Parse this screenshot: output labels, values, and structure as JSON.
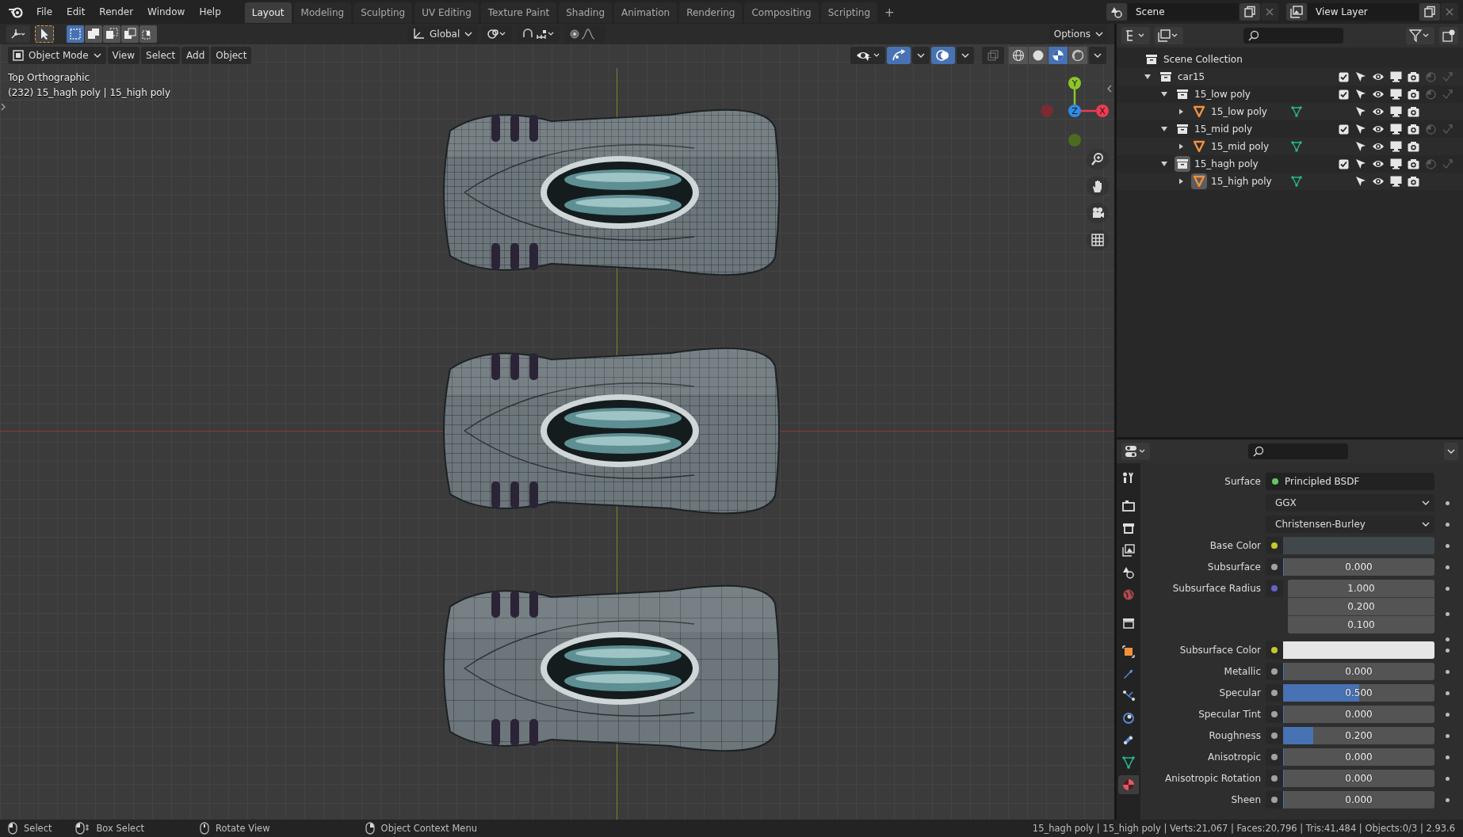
{
  "top_bar": {
    "menus": [
      "File",
      "Edit",
      "Render",
      "Window",
      "Help"
    ],
    "workspaces": [
      {
        "label": "Layout",
        "selected": true
      },
      {
        "label": "Modeling",
        "selected": false
      },
      {
        "label": "Sculpting",
        "selected": false
      },
      {
        "label": "UV Editing",
        "selected": false
      },
      {
        "label": "Texture Paint",
        "selected": false
      },
      {
        "label": "Shading",
        "selected": false
      },
      {
        "label": "Animation",
        "selected": false
      },
      {
        "label": "Rendering",
        "selected": false
      },
      {
        "label": "Compositing",
        "selected": false
      },
      {
        "label": "Scripting",
        "selected": false
      }
    ],
    "add_tab": "+",
    "scene": "Scene",
    "view_layer": "View Layer"
  },
  "viewport": {
    "select_modes": [
      {
        "kind": "set",
        "selected": true
      },
      {
        "kind": "extend",
        "selected": false
      },
      {
        "kind": "subtract",
        "selected": false
      },
      {
        "kind": "invert",
        "selected": false
      },
      {
        "kind": "intersect",
        "selected": false
      }
    ],
    "orientation": "Global",
    "options": "Options",
    "mode": "Object Mode",
    "menus": [
      "View",
      "Select",
      "Add",
      "Object"
    ],
    "shading": [
      {
        "kind": "wireframe",
        "selected": false
      },
      {
        "kind": "solid",
        "selected": false
      },
      {
        "kind": "material",
        "selected": true
      },
      {
        "kind": "rendered",
        "selected": false
      }
    ],
    "view_name": "Top Orthographic",
    "active_info": "(232) 15_hagh poly | 15_high poly",
    "gizmo": {
      "y": "Y",
      "z": "Z",
      "x": "X"
    }
  },
  "outliner": {
    "items": [
      {
        "kind": "collection",
        "label": "Scene Collection",
        "selected": false,
        "children": [
          {
            "kind": "collection",
            "label": "car15",
            "expanded": true,
            "checked": true,
            "selected": false,
            "children": [
              {
                "kind": "collection",
                "label": "15_low poly",
                "expanded": true,
                "checked": true,
                "selected": false,
                "children": [
                  {
                    "kind": "object",
                    "label": "15_low poly",
                    "expanded": false,
                    "selected": false
                  }
                ]
              },
              {
                "kind": "collection",
                "label": "15_mid poly",
                "expanded": true,
                "checked": true,
                "selected": false,
                "children": [
                  {
                    "kind": "object",
                    "label": "15_mid poly",
                    "expanded": false,
                    "selected": false
                  }
                ]
              },
              {
                "kind": "collection",
                "label": "15_hagh poly",
                "expanded": true,
                "checked": true,
                "selected": true,
                "children": [
                  {
                    "kind": "object",
                    "label": "15_high poly",
                    "expanded": false,
                    "selected": true
                  }
                ]
              }
            ]
          }
        ]
      }
    ]
  },
  "properties": {
    "tabs": [
      {
        "kind": "tool",
        "selected": false
      },
      {
        "kind": "render",
        "selected": false
      },
      {
        "kind": "output",
        "selected": false
      },
      {
        "kind": "view_layer",
        "selected": false
      },
      {
        "kind": "scene",
        "selected": false
      },
      {
        "kind": "world",
        "selected": false
      },
      {
        "kind": "collection",
        "selected": false
      },
      {
        "kind": "object",
        "selected": false
      },
      {
        "kind": "modifier",
        "selected": false
      },
      {
        "kind": "particles",
        "selected": false
      },
      {
        "kind": "physics",
        "selected": false
      },
      {
        "kind": "constraint",
        "selected": false
      },
      {
        "kind": "data",
        "selected": false
      },
      {
        "kind": "material",
        "selected": true
      }
    ],
    "rows": [
      {
        "kind": "link",
        "label": "Surface",
        "color": "#63c763",
        "value": "Principled BSDF"
      },
      {
        "kind": "dropdown",
        "value": "GGX"
      },
      {
        "kind": "dropdown",
        "value": "Christensen-Burley"
      },
      {
        "kind": "color",
        "label": "Base Color",
        "color": "#c7c729",
        "swatch": {
          "color": "#41484c"
        }
      },
      {
        "kind": "slider",
        "label": "Subsurface",
        "color": "#a1a1a1",
        "value": "0.000",
        "level": 0
      },
      {
        "kind": "vector",
        "label": "Subsurface Radius",
        "color": "#6363c7",
        "values": [
          "1.000",
          "0.200",
          "0.100"
        ]
      },
      {
        "kind": "color",
        "label": "Subsurface Color",
        "color": "#c7c729",
        "swatch": {
          "color": "#e6e6e6"
        }
      },
      {
        "kind": "slider",
        "label": "Metallic",
        "color": "#a1a1a1",
        "value": "0.000",
        "level": 0
      },
      {
        "kind": "slider",
        "label": "Specular",
        "color": "#a1a1a1",
        "value": "0.500",
        "level": 0.5
      },
      {
        "kind": "slider",
        "label": "Specular Tint",
        "color": "#a1a1a1",
        "value": "0.000",
        "level": 0
      },
      {
        "kind": "slider",
        "label": "Roughness",
        "color": "#a1a1a1",
        "value": "0.200",
        "level": 0.2
      },
      {
        "kind": "slider",
        "label": "Anisotropic",
        "color": "#a1a1a1",
        "value": "0.000",
        "level": 0
      },
      {
        "kind": "slider",
        "label": "Anisotropic Rotation",
        "color": "#a1a1a1",
        "value": "0.000",
        "level": 0
      },
      {
        "kind": "slider",
        "label": "Sheen",
        "color": "#a1a1a1",
        "value": "0.000",
        "level": 0
      }
    ]
  },
  "status_bar": {
    "hints": [
      {
        "kind": "lmb",
        "label": "Select"
      },
      {
        "kind": "lmb_drag",
        "label": "Box Select"
      },
      {
        "kind": "mmb",
        "label": "Rotate View"
      },
      {
        "kind": "rmb",
        "label": "Object Context Menu"
      }
    ],
    "stats": "15_hagh poly | 15_high poly | Verts:21,067 | Faces:20,796 | Tris:41,484 | Objects:0/3 | 2.93.6"
  }
}
